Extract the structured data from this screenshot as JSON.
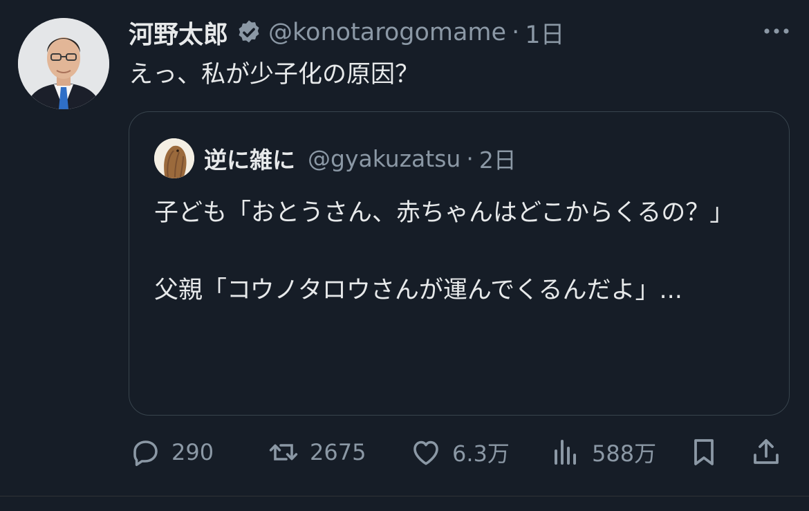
{
  "tweet": {
    "author_name": "河野太郎",
    "handle": "@konotarogomame",
    "separator": "·",
    "time": "1日",
    "text": "えっ、私が少子化の原因？",
    "avatar_icon": "profile-photo"
  },
  "quote": {
    "author_name": "逆に雑に",
    "handle": "@gyakuzatsu",
    "separator": "·",
    "time": "2日",
    "text": "子ども「おとうさん、赤ちゃんはどこからくるの？」\n\n父親「コウノタロウさんが運んでくるんだよ」...",
    "avatar_icon": "kiwi-bird-avatar"
  },
  "actions": {
    "replies": "290",
    "retweets": "2675",
    "likes": "6.3万",
    "views": "588万"
  },
  "colors": {
    "background": "#161d27",
    "text": "#e7e9ea",
    "muted": "#8b98a5",
    "border": "#38444d"
  }
}
